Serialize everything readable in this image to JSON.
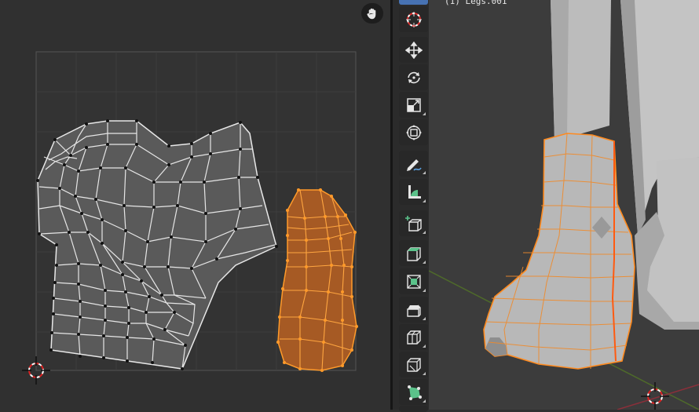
{
  "uv_editor": {
    "background": "#303030",
    "grid_color": "#3e3e3e",
    "grey_island_fill": "#5a5a5a",
    "selected_island_fill": "#a65a24",
    "selected_edge_color": "#ff9a2a",
    "navigation_tool": "hand-icon",
    "cursor": "3d-cursor-icon"
  },
  "toolbar": {
    "tools": [
      {
        "name": "cursor-tool",
        "icon": "cursor-icon"
      },
      {
        "name": "move-tool",
        "icon": "move-arrows-icon"
      },
      {
        "name": "rotate-tool",
        "icon": "rotate-icon"
      },
      {
        "name": "scale-tool",
        "icon": "scale-icon"
      },
      {
        "name": "transform-tool",
        "icon": "transform-icon"
      },
      {
        "name": "annotate-tool",
        "icon": "pencil-icon"
      },
      {
        "name": "measure-tool",
        "icon": "ruler-icon"
      },
      {
        "name": "add-cube-tool",
        "icon": "add-cube-icon"
      },
      {
        "name": "extrude-tool",
        "icon": "extrude-icon"
      },
      {
        "name": "inset-tool",
        "icon": "inset-icon"
      },
      {
        "name": "bevel-tool",
        "icon": "bevel-icon"
      },
      {
        "name": "loop-cut-tool",
        "icon": "loop-cut-icon"
      },
      {
        "name": "knife-tool",
        "icon": "knife-icon"
      },
      {
        "name": "poly-build-tool",
        "icon": "poly-build-icon"
      }
    ]
  },
  "viewport": {
    "object_label": "(1) Legs.001",
    "background": "#3c3c3c",
    "mesh_color": "#c8c8c8",
    "selection_color": "#ff8a1e",
    "x_axis_color": "#8b2f3a",
    "y_axis_color": "#5a7a2a"
  }
}
